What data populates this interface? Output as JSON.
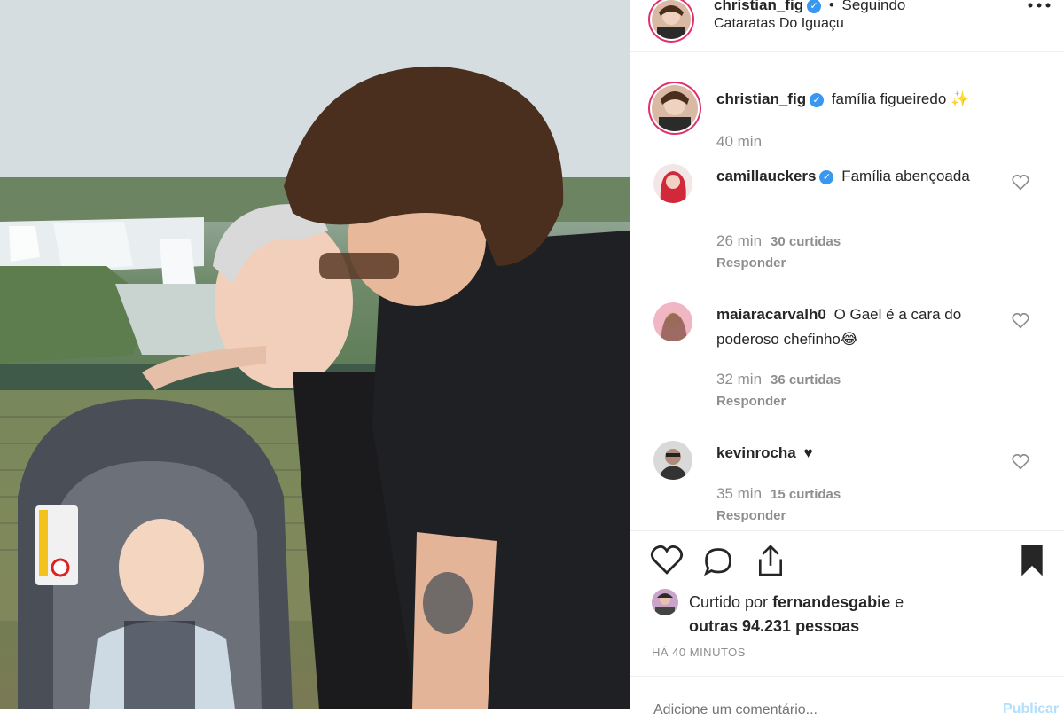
{
  "post": {
    "author": "christian_fig",
    "follow_status": "Seguindo",
    "location": "Cataratas Do Iguaçu",
    "caption": "família figueiredo",
    "caption_emoji": "✨",
    "caption_time": "40 min"
  },
  "comments": [
    {
      "user": "camillauckers",
      "verified": true,
      "text": "Família abençoada",
      "time": "26 min",
      "likes": "30 curtidas",
      "reply": "Responder"
    },
    {
      "user": "maiaracarvalh0",
      "verified": false,
      "text": "O Gael é a cara do poderoso chefinho😂",
      "time": "32 min",
      "likes": "36 curtidas",
      "reply": "Responder"
    },
    {
      "user": "kevinrocha",
      "verified": false,
      "text": "♥",
      "time": "35 min",
      "likes": "15 curtidas",
      "reply": "Responder"
    }
  ],
  "likes_summary": {
    "prefix": "Curtido por",
    "user": "fernandesgabie",
    "middle": "e",
    "others": "outras 94.231 pessoas"
  },
  "timestamp": "HÁ 40 MINUTOS",
  "add_comment": {
    "placeholder": "Adicione um comentário...",
    "publish": "Publicar"
  },
  "icons": {
    "verified": "verified-badge-icon",
    "more": "more-options-icon",
    "like": "heart-icon",
    "comment": "comment-bubble-icon",
    "share": "share-icon",
    "save": "bookmark-icon"
  },
  "colors": {
    "verified": "#3897f0",
    "text": "#262626",
    "muted": "#8e8e8e",
    "story_ring": "#e1306c"
  }
}
